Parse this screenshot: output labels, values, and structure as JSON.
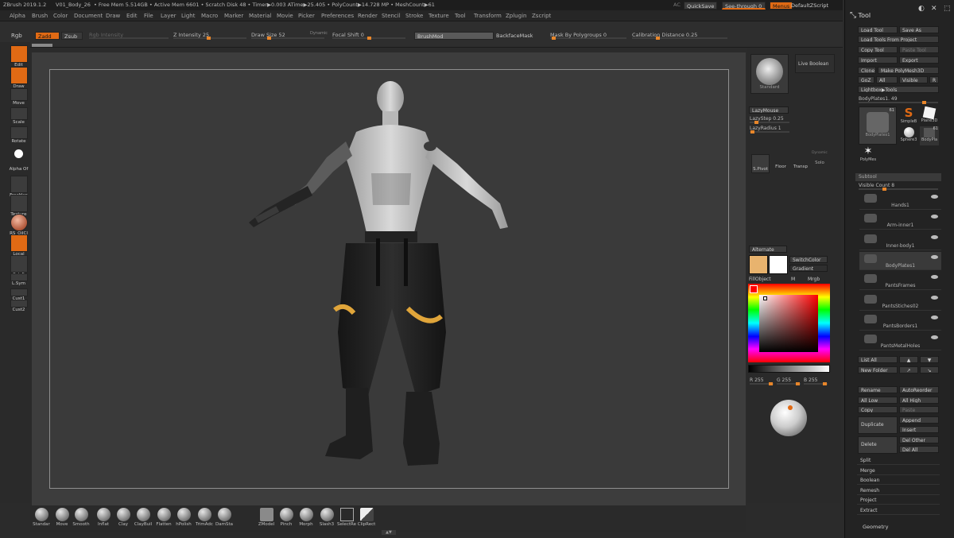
{
  "titlebar": {
    "app": "ZBrush 2019.1.2",
    "doc": "V01_Body_26",
    "stats": "• Free Mem 5.514GB • Active Mem 6601 • Scratch Disk 48 • Timer▶0.003 ATime▶25.405 • PolyCount▶14.728 MP • MeshCount▶61",
    "ac": "AC",
    "quicksave": "QuickSave",
    "seethrough": "See-through  0",
    "menus": "Menus",
    "script": "DefaultZScript"
  },
  "menu": [
    "Alpha",
    "Brush",
    "Color",
    "Document",
    "Draw",
    "Edit",
    "File",
    "Layer",
    "Light",
    "Macro",
    "Marker",
    "Material",
    "Movie",
    "Picker",
    "Preferences",
    "Render",
    "Stencil",
    "Stroke",
    "Texture",
    "Tool",
    "Transform",
    "Zplugin",
    "Zscript"
  ],
  "shelf": {
    "rgb": "Rgb",
    "zadd": "Zadd",
    "zsub": "Zsub",
    "rgb_intensity": "Rgb Intensity",
    "z_intensity": "Z Intensity 25",
    "draw_size": "Draw Size 52",
    "dynamic": "Dynamic",
    "focal_shift": "Focal Shift 0",
    "brushmod": "BrushMod",
    "backface": "BackfaceMask",
    "mask_polygroups": "Mask By Polygroups 0",
    "calibration": "Calibration Distance 0.25"
  },
  "left_tools": [
    {
      "label": "Edit",
      "active": true
    },
    {
      "label": "Draw",
      "active": true
    },
    {
      "label": "Move",
      "active": false
    },
    {
      "label": "Scale",
      "active": false
    },
    {
      "label": "Rotate",
      "active": false
    },
    {
      "label": "Alpha Of",
      "active": false
    },
    {
      "label": "FreeHan",
      "active": false
    },
    {
      "label": "Texture",
      "active": false
    },
    {
      "label": "RS_OilCl",
      "active": false
    },
    {
      "label": "Local",
      "active": true
    },
    {
      "label": "PolyF",
      "active": false
    },
    {
      "label": "L.Sym",
      "active": false
    },
    {
      "label": "Cust1",
      "active": false
    },
    {
      "label": "Cust2",
      "active": false
    }
  ],
  "right_mid": {
    "standard": "Standard",
    "live_boolean": "Live Boolean",
    "lazymouse": "LazyMouse",
    "lazystep": "LazyStep 0.25",
    "lazyradius": "LazyRadius 1",
    "spivot": "S.Pivot",
    "floor": "Floor",
    "transp": "Transp",
    "solo": "Solo",
    "dynamic": "Dynamic",
    "alternate": "Alternate",
    "switchcolor": "SwitchColor",
    "gradient": "Gradient",
    "fillobject": "FillObject",
    "m": "M",
    "mrgb": "Mrgb",
    "r": "R 255",
    "g": "G 255",
    "b": "B 255"
  },
  "tool": {
    "title": "Tool",
    "load_tool": "Load Tool",
    "save_as": "Save As",
    "load_from_project": "Load Tools From Project",
    "copy_tool": "Copy Tool",
    "paste_tool": "Paste Tool",
    "import": "Import",
    "export": "Export",
    "clone": "Clone",
    "make_polymesh": "Make PolyMesh3D",
    "goz": "GoZ",
    "all": "All",
    "visible": "Visible",
    "r": "R",
    "lightbox_tools": "Lightbox▶Tools",
    "current": "BodyPlates1. 49",
    "thumbs": [
      {
        "label": "BodyPlates1",
        "badge": "61"
      },
      {
        "label": "SimpleB",
        "badge": ""
      },
      {
        "label": "Plane3D",
        "badge": ""
      },
      {
        "label": "Sphere3",
        "badge": ""
      },
      {
        "label": "BodyPla",
        "badge": "61"
      },
      {
        "label": "PolyMes",
        "badge": ""
      }
    ],
    "subtool": "Subtool",
    "visible_count": "Visible Count 8",
    "subtools": [
      "Hands1",
      "Arm-inner1",
      "Inner-body1",
      "BodyPlates1",
      "PantsFrames",
      "PantsStiches02",
      "PantsBorders1",
      "PantsMetalHoles"
    ],
    "list_all": "List All",
    "new_folder": "New Folder",
    "rename": "Rename",
    "autoreorder": "AutoReorder",
    "all_low": "All Low",
    "all_high": "All High",
    "copy": "Copy",
    "paste": "Paste",
    "duplicate": "Duplicate",
    "append": "Append",
    "insert": "Insert",
    "delete": "Delete",
    "del_other": "Del Other",
    "del_all": "Del All",
    "sections": [
      "Split",
      "Merge",
      "Boolean",
      "Remesh",
      "Project",
      "Extract"
    ],
    "geometry": "Geometry"
  },
  "brushes": [
    "Standar",
    "Move",
    "Smooth",
    "Inflat",
    "Clay",
    "ClayBuil",
    "Flatten",
    "hPolish",
    "TrimAdc",
    "DamSta",
    "ZModel",
    "Pinch",
    "Morph",
    "Slash3",
    "SelectRe",
    "ClipRect"
  ],
  "colors": {
    "accent": "#e06a14",
    "bg": "#2b2b2b",
    "canvas": "#3d3d3d"
  }
}
